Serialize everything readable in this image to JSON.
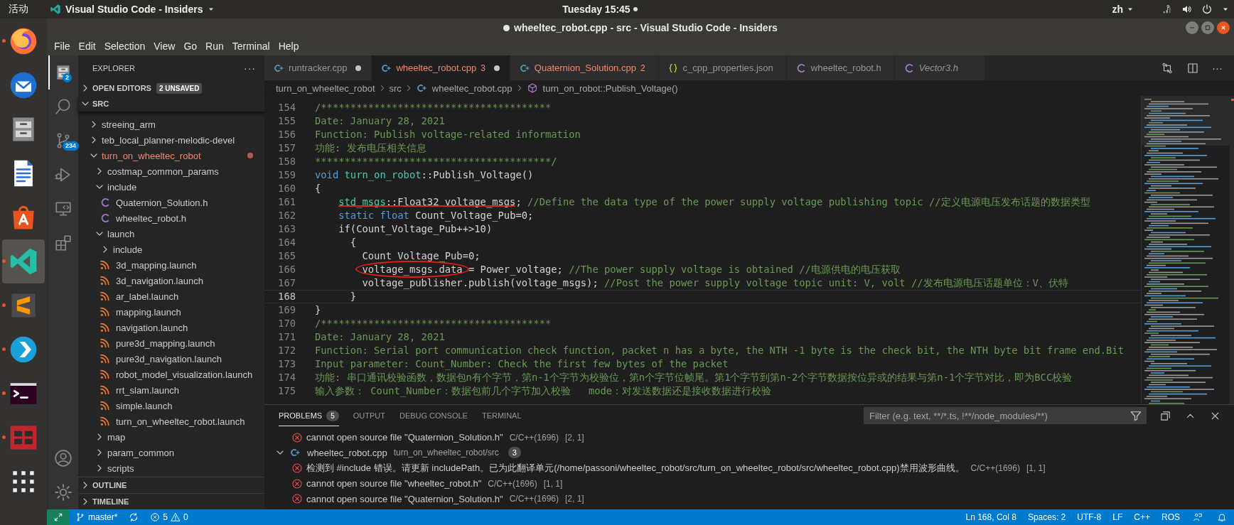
{
  "top_bar": {
    "activities": "活动",
    "app_menu": "Visual Studio Code - Insiders",
    "clock": "Tuesday 15:45",
    "clock_dot": true,
    "input_method": "zh"
  },
  "dock": [
    {
      "kind": "firefox",
      "running": true,
      "selected": false
    },
    {
      "kind": "thunderbird",
      "running": false,
      "selected": false
    },
    {
      "kind": "files",
      "running": false,
      "selected": false
    },
    {
      "kind": "writer",
      "running": false,
      "selected": false
    },
    {
      "kind": "software",
      "running": false,
      "selected": false
    },
    {
      "kind": "vscode",
      "running": true,
      "selected": true
    },
    {
      "kind": "sublime",
      "running": true,
      "selected": false
    },
    {
      "kind": "kodi",
      "running": true,
      "selected": false
    },
    {
      "kind": "terminal",
      "running": true,
      "selected": false
    },
    {
      "kind": "redapp",
      "running": true,
      "selected": false
    },
    {
      "kind": "apps",
      "running": false,
      "selected": false
    }
  ],
  "window": {
    "title": "wheeltec_robot.cpp - src - Visual Studio Code - Insiders",
    "modified": true
  },
  "menu": [
    "File",
    "Edit",
    "Selection",
    "View",
    "Go",
    "Run",
    "Terminal",
    "Help"
  ],
  "activity_bar": [
    {
      "kind": "explorer",
      "badge": "2",
      "selected": true
    },
    {
      "kind": "search",
      "selected": false
    },
    {
      "kind": "source_control",
      "badge": "234",
      "selected": false
    },
    {
      "kind": "run",
      "selected": false
    },
    {
      "kind": "remote",
      "selected": false
    },
    {
      "kind": "extensions",
      "selected": false
    }
  ],
  "activity_bottom": [
    {
      "kind": "account"
    },
    {
      "kind": "settings"
    }
  ],
  "explorer": {
    "title": "EXPLORER",
    "more": "···",
    "open_editors": {
      "label": "OPEN EDITORS",
      "badge": "2 UNSAVED",
      "expanded": false
    },
    "root": {
      "label": "SRC",
      "expanded": true
    },
    "tree": [
      {
        "name": "streeing_arm",
        "kind": "folder",
        "expanded": false,
        "error": false
      },
      {
        "name": "teb_local_planner-melodic-devel",
        "kind": "folder",
        "expanded": false,
        "error": false
      },
      {
        "name": "turn_on_wheeltec_robot",
        "kind": "folder",
        "expanded": true,
        "error": true,
        "children": [
          {
            "name": "costmap_common_params",
            "kind": "folder",
            "expanded": false,
            "error": false
          },
          {
            "name": "include",
            "kind": "folder",
            "expanded": true,
            "error": false,
            "children": [
              {
                "name": "Quaternion_Solution.h",
                "kind": "c",
                "error": false
              },
              {
                "name": "wheeltec_robot.h",
                "kind": "c",
                "error": false
              }
            ]
          },
          {
            "name": "launch",
            "kind": "folder",
            "expanded": true,
            "error": false,
            "children": [
              {
                "name": "include",
                "kind": "folder",
                "expanded": false,
                "error": false
              },
              {
                "name": "3d_mapping.launch",
                "kind": "launch",
                "error": false
              },
              {
                "name": "3d_navigation.launch",
                "kind": "launch",
                "error": false
              },
              {
                "name": "ar_label.launch",
                "kind": "launch",
                "error": false
              },
              {
                "name": "mapping.launch",
                "kind": "launch",
                "error": false
              },
              {
                "name": "navigation.launch",
                "kind": "launch",
                "error": false
              },
              {
                "name": "pure3d_mapping.launch",
                "kind": "launch",
                "error": false
              },
              {
                "name": "pure3d_navigation.launch",
                "kind": "launch",
                "error": false
              },
              {
                "name": "robot_model_visualization.launch",
                "kind": "launch",
                "error": false
              },
              {
                "name": "rrt_slam.launch",
                "kind": "launch",
                "error": false
              },
              {
                "name": "simple.launch",
                "kind": "launch",
                "error": false
              },
              {
                "name": "turn_on_wheeltec_robot.launch",
                "kind": "launch",
                "error": false
              }
            ]
          },
          {
            "name": "map",
            "kind": "folder",
            "expanded": false,
            "error": false
          },
          {
            "name": "param_common",
            "kind": "folder",
            "expanded": false,
            "error": false
          },
          {
            "name": "scripts",
            "kind": "folder",
            "expanded": false,
            "error": false
          }
        ]
      }
    ],
    "outline": {
      "label": "OUTLINE",
      "expanded": false
    },
    "timeline": {
      "label": "TIMELINE",
      "expanded": false
    }
  },
  "tabs": [
    {
      "label": "runtracker.cpp",
      "kind": "cpp",
      "modified": true,
      "selected": false,
      "error": false,
      "preview": false
    },
    {
      "label": "wheeltec_robot.cpp",
      "kind": "cpp",
      "badge": "3",
      "modified": true,
      "selected": true,
      "error": true,
      "preview": false
    },
    {
      "label": "Quaternion_Solution.cpp",
      "kind": "cpp",
      "badge": "2",
      "modified": false,
      "selected": false,
      "error": true,
      "preview": false
    },
    {
      "label": "c_cpp_properties.json",
      "kind": "json",
      "modified": false,
      "selected": false,
      "error": false,
      "preview": false
    },
    {
      "label": "wheeltec_robot.h",
      "kind": "c",
      "modified": false,
      "selected": false,
      "error": false,
      "preview": false
    },
    {
      "label": "Vector3.h",
      "kind": "c",
      "modified": false,
      "selected": false,
      "error": false,
      "preview": true
    }
  ],
  "editor_more": "···",
  "breadcrumbs": [
    {
      "label": "turn_on_wheeltec_robot",
      "kind": "folder"
    },
    {
      "label": "src",
      "kind": "folder"
    },
    {
      "label": "wheeltec_robot.cpp",
      "kind": "cpp"
    },
    {
      "label": "turn_on_robot::Publish_Voltage()",
      "kind": "method"
    }
  ],
  "code": [
    {
      "number": "154",
      "current": false,
      "segments": [
        {
          "kind": "comment",
          "text": "/***************************************"
        }
      ]
    },
    {
      "number": "155",
      "current": false,
      "segments": [
        {
          "kind": "comment",
          "text": "Date: January 28, 2021"
        }
      ]
    },
    {
      "number": "156",
      "current": false,
      "segments": [
        {
          "kind": "comment",
          "text": "Function: Publish voltage-related information"
        }
      ]
    },
    {
      "number": "157",
      "current": false,
      "segments": [
        {
          "kind": "comment",
          "text": "功能: 发布电压相关信息"
        }
      ]
    },
    {
      "number": "158",
      "current": false,
      "segments": [
        {
          "kind": "comment",
          "text": "****************************************/"
        }
      ]
    },
    {
      "number": "159",
      "current": false,
      "segments": [
        {
          "kind": "keyword",
          "text": "void "
        },
        {
          "kind": "type",
          "text": "turn_on_robot"
        },
        {
          "kind": "plain",
          "text": "::Publish_Voltage()"
        }
      ]
    },
    {
      "number": "160",
      "current": false,
      "segments": [
        {
          "kind": "plain",
          "text": "{"
        }
      ]
    },
    {
      "number": "161",
      "current": false,
      "segments": [
        {
          "kind": "type",
          "text": "    std_msgs",
          "underlined": true
        },
        {
          "kind": "plain",
          "text": "::Float32 voltage_msgs",
          "underlined": true
        },
        {
          "kind": "plain",
          "text": "; ",
          "underlined": false
        },
        {
          "kind": "comment",
          "text": "//Define the data type of the power supply voltage publishing topic //定义电源电压发布话题的数据类型",
          "underlined": false
        }
      ]
    },
    {
      "number": "162",
      "current": false,
      "segments": [
        {
          "kind": "keyword",
          "text": "    static float"
        },
        {
          "kind": "plain",
          "text": " Count_Voltage_Pub=0;"
        }
      ]
    },
    {
      "number": "163",
      "current": false,
      "segments": [
        {
          "kind": "plain",
          "text": "    if(Count_Voltage_Pub++>10)"
        }
      ]
    },
    {
      "number": "164",
      "current": false,
      "segments": [
        {
          "kind": "plain",
          "text": "      {"
        }
      ]
    },
    {
      "number": "165",
      "current": false,
      "segments": [
        {
          "kind": "plain",
          "text": "        Count_Voltage_Pub=0;"
        }
      ]
    },
    {
      "number": "166",
      "current": false,
      "segments": [
        {
          "kind": "plain",
          "text": "        voltage_msgs.data",
          "circled": true
        },
        {
          "kind": "plain",
          "text": " = Power_voltage; ",
          "circled": false
        },
        {
          "kind": "comment",
          "text": "//The power supply voltage is obtained //电源供电的电压获取",
          "circled": false
        }
      ]
    },
    {
      "number": "167",
      "current": false,
      "segments": [
        {
          "kind": "plain",
          "text": "        voltage_publisher.publish(voltage_msgs); "
        },
        {
          "kind": "comment",
          "text": "//Post the power supply voltage topic unit: V, volt //发布电源电压话题单位：V、伏特"
        }
      ]
    },
    {
      "number": "168",
      "current": true,
      "segments": [
        {
          "kind": "plain",
          "text": "      }"
        }
      ]
    },
    {
      "number": "169",
      "current": false,
      "segments": [
        {
          "kind": "plain",
          "text": "}"
        }
      ]
    },
    {
      "number": "170",
      "current": false,
      "segments": [
        {
          "kind": "comment",
          "text": "/***************************************"
        }
      ]
    },
    {
      "number": "171",
      "current": false,
      "segments": [
        {
          "kind": "comment",
          "text": "Date: January 28, 2021"
        }
      ]
    },
    {
      "number": "172",
      "current": false,
      "segments": [
        {
          "kind": "comment",
          "text": "Function: Serial port communication check function, packet n has a byte, the NTH -1 byte is the check bit, the NTH byte bit frame end.Bit"
        }
      ]
    },
    {
      "number": "173",
      "current": false,
      "segments": [
        {
          "kind": "comment",
          "text": "Input parameter: Count_Number: Check the first few bytes of the packet"
        }
      ]
    },
    {
      "number": "174",
      "current": false,
      "segments": [
        {
          "kind": "comment",
          "text": "功能: 串口通讯校验函数，数据包n有个字节，第n-1个字节为校验位，第n个字节位帧尾。第1个字节到第n-2个字节数据按位异或的结果与第n-1个字节对比，即为BCC校验"
        }
      ]
    },
    {
      "number": "175",
      "current": false,
      "segments": [
        {
          "kind": "comment",
          "text": "输入参数： Count_Number：数据包前几个字节加入校验   mode：对发送数据还是接收数据进行校验"
        }
      ]
    }
  ],
  "panel": {
    "tabs": [
      {
        "label": "PROBLEMS",
        "badge": "5",
        "selected": true
      },
      {
        "label": "OUTPUT",
        "selected": false
      },
      {
        "label": "DEBUG CONSOLE",
        "selected": false
      },
      {
        "label": "TERMINAL",
        "selected": false
      }
    ],
    "filter_placeholder": "Filter (e.g. text, **/*.ts, !**/node_modules/**)",
    "entries": [
      {
        "kind": "error",
        "text": "cannot open source file \"Quaternion_Solution.h\"",
        "source": "C/C++(1696)",
        "position": "[2, 1]"
      },
      {
        "kind": "file",
        "name": "wheeltec_robot.cpp",
        "path": "turn_on_wheeltec_robot/src",
        "count": "3",
        "expanded": true,
        "children": [
          {
            "kind": "error",
            "text": "检测到 #include 错误。请更新 includePath。已为此翻译单元(/home/passoni/wheeltec_robot/src/turn_on_wheeltec_robot/src/wheeltec_robot.cpp)禁用波形曲线。",
            "source": "C/C++(1696)",
            "position": "[1, 1]"
          },
          {
            "kind": "error",
            "text": "cannot open source file \"wheeltec_robot.h\"",
            "source": "C/C++(1696)",
            "position": "[1, 1]"
          },
          {
            "kind": "error",
            "text": "cannot open source file \"Quaternion_Solution.h\"",
            "source": "C/C++(1696)",
            "position": "[2, 1]"
          }
        ]
      }
    ]
  },
  "status_bar": {
    "branch": "master*",
    "errors": "5",
    "warnings": "0",
    "items": [
      "Ln 168, Col 8",
      "Spaces: 2",
      "UTF-8",
      "LF",
      "C++",
      "ROS"
    ]
  }
}
